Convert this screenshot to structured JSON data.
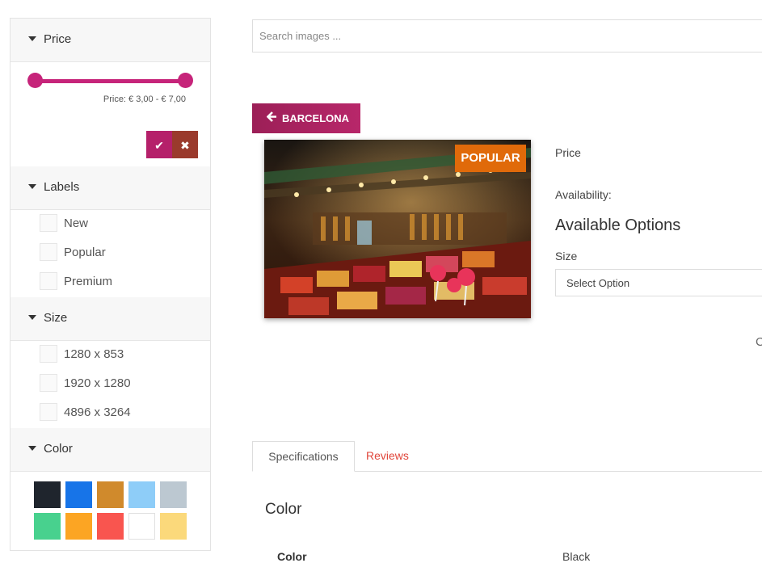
{
  "filters": {
    "price": {
      "title": "Price",
      "range_label": "Price: € 3,00 - € 7,00",
      "apply_icon": "check-icon",
      "clear_icon": "x-icon",
      "apply_glyph": "✔",
      "clear_glyph": "✖",
      "accent_color": "#c6247a"
    },
    "labels": {
      "title": "Labels",
      "options": [
        "New",
        "Popular",
        "Premium"
      ]
    },
    "size": {
      "title": "Size",
      "options": [
        "1280 x 853",
        "1920 x 1280",
        "4896 x 3264"
      ]
    },
    "color": {
      "title": "Color",
      "swatches": [
        "#1f252d",
        "#1774e8",
        "#d08a2c",
        "#8ecdf8",
        "#bcc8d1",
        "#48d18e",
        "#fca523",
        "#f9554f",
        "#ffffff",
        "#fbd97b"
      ]
    }
  },
  "search": {
    "placeholder": "Search images ..."
  },
  "product": {
    "back_label": "BARCELONA",
    "back_icon": "arrow-left-icon",
    "back_glyph": "🡐",
    "badge": "POPULAR",
    "badge_color": "#e06a0a",
    "price_label": "Price",
    "availability_label": "Availability:",
    "options_title": "Available Options",
    "size_label": "Size",
    "size_select_value": "Select Option",
    "cut_text": "C"
  },
  "tabs": {
    "items": [
      "Specifications",
      "Reviews"
    ],
    "active": "Specifications"
  },
  "specs": {
    "section_title": "Color",
    "rows": [
      {
        "key": "Color",
        "value": "Black"
      }
    ]
  }
}
